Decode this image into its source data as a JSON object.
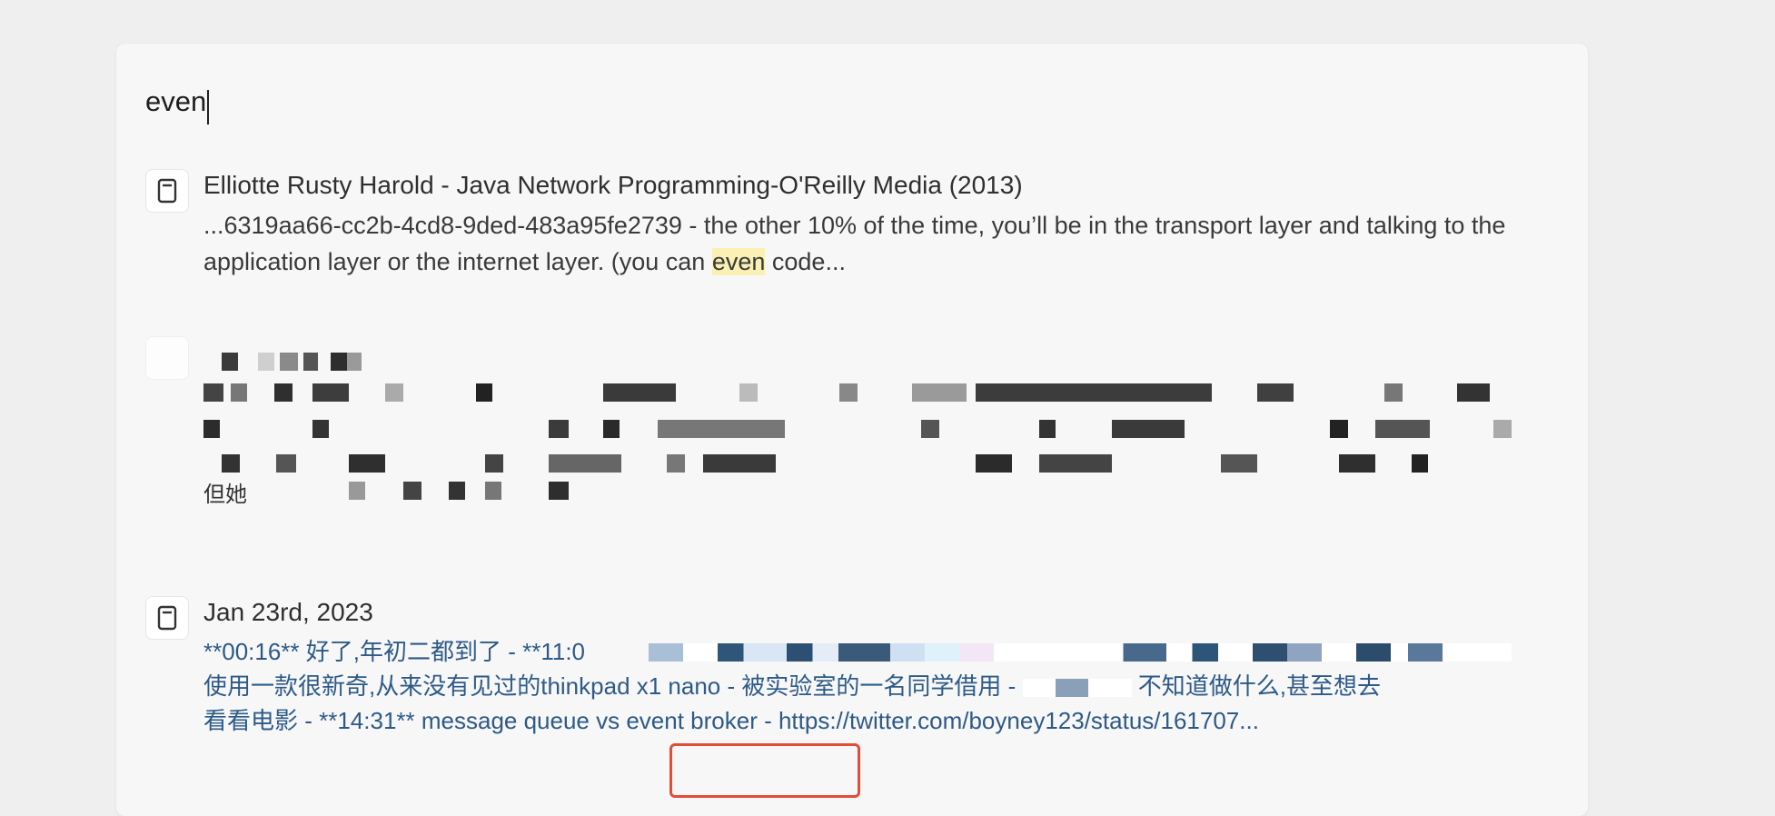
{
  "search": {
    "value": "even"
  },
  "results": [
    {
      "title": "Elliotte Rusty Harold - Java Network Programming-O'Reilly Media (2013)",
      "snippet_before": "...6319aa66-cc2b-4cd8-9ded-483a95fe2739 - the other 10% of the time, you’ll be in the transport layer and talking to the application layer or the internet layer. (you can ",
      "snippet_highlight": "even",
      "snippet_after": " code..."
    },
    {
      "title": "",
      "visible_fragment": "但她"
    },
    {
      "title": "Jan 23rd, 2023",
      "snippet_line1": "**00:16** 好了,年初二都到了 - **11:0",
      "snippet_line2": "使用一款很新奇,从来没有见过的thinkpad x1 nano - 被实验室的一名同学借用 -",
      "snippet_line2_end": "不知道做什么,甚至想去",
      "snippet_line3": "看看电影 - **14:31** message queue vs event broker - https://twitter.com/boyney123/status/161707..."
    }
  ],
  "colors": {
    "highlight": "#fbf0b4",
    "annotation": "#e34c36",
    "link_text": "#2d5a88"
  },
  "icons": {
    "result_icon": "page-icon"
  }
}
